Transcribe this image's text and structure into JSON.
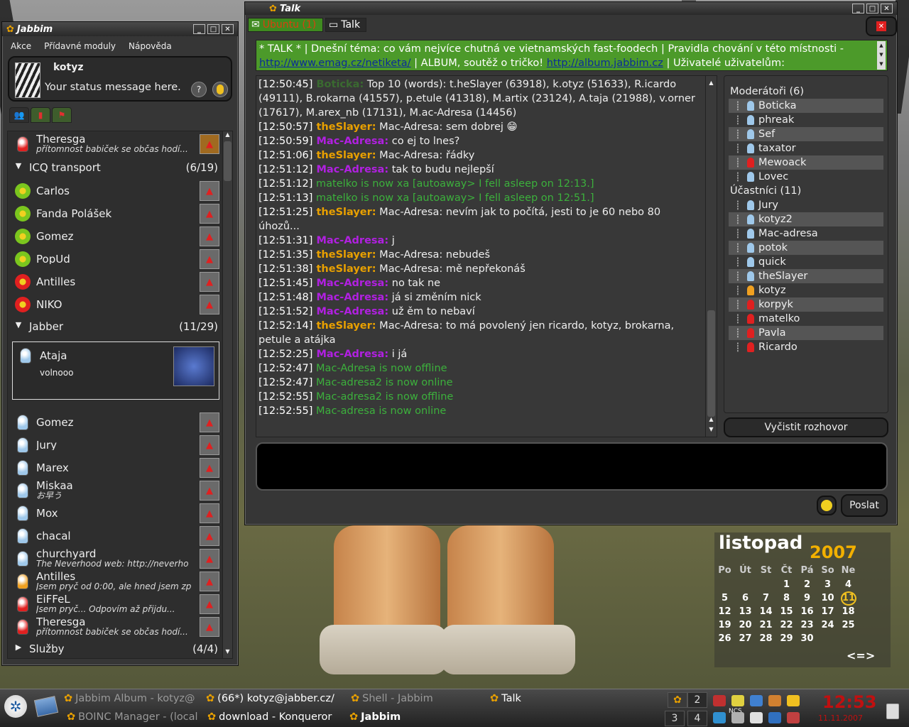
{
  "jabbim": {
    "title": "Jabbim",
    "menu": [
      "Akce",
      "Přídavné moduly",
      "Nápověda"
    ],
    "self": {
      "name": "kotyz",
      "status": "Your status message here."
    },
    "top_contact": {
      "name": "Theresga",
      "sub": "přítomnost babiček se občas hodí..."
    },
    "groups": {
      "icq": {
        "label": "ICQ transport",
        "count": "(6/19)"
      },
      "jabber": {
        "label": "Jabber",
        "count": "(11/29)"
      },
      "sluzby": {
        "label": "Služby",
        "count": "(4/4)"
      }
    },
    "icq_contacts": [
      {
        "name": "Carlos",
        "color": "#7bc61e"
      },
      {
        "name": "Fanda Polášek",
        "color": "#7bc61e"
      },
      {
        "name": "Gomez",
        "color": "#7bc61e"
      },
      {
        "name": "PopUd",
        "color": "#7bc61e"
      },
      {
        "name": "Antilles",
        "color": "#e02020"
      },
      {
        "name": "NIKO",
        "color": "#e02020"
      }
    ],
    "selected": {
      "name": "Ataja",
      "sub": "volnooo"
    },
    "jabber_contacts": [
      {
        "name": "Gomez",
        "sub": "",
        "color": "#9fc8ea"
      },
      {
        "name": "Jury",
        "sub": "",
        "color": "#9fc8ea"
      },
      {
        "name": "Marex",
        "sub": "",
        "color": "#9fc8ea"
      },
      {
        "name": "Miskaa",
        "sub": "お早う",
        "color": "#9fc8ea"
      },
      {
        "name": "Mox",
        "sub": "",
        "color": "#9fc8ea"
      },
      {
        "name": "chacal",
        "sub": "",
        "color": "#9fc8ea"
      },
      {
        "name": "churchyard",
        "sub": "The Neverhood web: http://neverho",
        "color": "#9fc8ea"
      },
      {
        "name": "Antilles",
        "sub": "Jsem pryč od 0:00, ale hned jsem zp",
        "color": "#f0a020"
      },
      {
        "name": "EiFFeL",
        "sub": "Jsem pryč... Odpovím až přijdu...",
        "color": "#e02020"
      },
      {
        "name": "Theresga",
        "sub": "přítomnost babiček se občas hodí...",
        "color": "#e02020"
      }
    ]
  },
  "talk": {
    "title": "Talk",
    "tabs": [
      "Ubuntu (1)",
      "Talk"
    ],
    "topic_pre": "* TALK * | Dnešní téma: co vám nejvíce chutná ve vietnamských fast-foodech | Pravidla chování v této místnosti - ",
    "topic_link1": "http://www.emag.cz/netiketa/",
    "topic_mid": " | ALBUM, soutěž o tričko! ",
    "topic_link2": "http://album.jabbim.cz",
    "topic_post": " | Uživatelé uživatelům:",
    "messages": [
      {
        "ts": "[12:50:45]",
        "nick": "Boticka:",
        "kind": "b",
        "text": " Top 10 (words): t.heSlayer (63918), k.otyz (51633), R.icardo (49111), B.rokarna (41557), p.etule (41318), M.artix (23124), A.taja (21988), v.orner (17617), M.arex_nb (17131), M.ac-Adresa (14456)"
      },
      {
        "ts": "[12:50:57]",
        "nick": "theSlayer:",
        "kind": "t",
        "text": " Mac-Adresa: sem dobrej 😁"
      },
      {
        "ts": "[12:50:59]",
        "nick": "Mac-Adresa:",
        "kind": "m",
        "text": " co ej to lnes?"
      },
      {
        "ts": "[12:51:06]",
        "nick": "theSlayer:",
        "kind": "t",
        "text": " Mac-Adresa: řádky"
      },
      {
        "ts": "[12:51:12]",
        "nick": "Mac-Adresa:",
        "kind": "m",
        "text": " tak to budu nejlepší"
      },
      {
        "ts": "[12:51:12]",
        "nick": "",
        "kind": "s",
        "text": " matelko is now xa [autoaway> I fell asleep on 12:13.]"
      },
      {
        "ts": "[12:51:13]",
        "nick": "",
        "kind": "s",
        "text": " matelko is now xa [autoaway> I fell asleep on 12:51.]"
      },
      {
        "ts": "[12:51:25]",
        "nick": "theSlayer:",
        "kind": "t",
        "text": " Mac-Adresa: nevím jak to počítá, jesti to je 60 nebo 80 úhozů..."
      },
      {
        "ts": "[12:51:31]",
        "nick": "Mac-Adresa:",
        "kind": "m",
        "text": " j"
      },
      {
        "ts": "[12:51:35]",
        "nick": "theSlayer:",
        "kind": "t",
        "text": " Mac-Adresa: nebudeš"
      },
      {
        "ts": "[12:51:38]",
        "nick": "theSlayer:",
        "kind": "t",
        "text": " Mac-Adresa: mě nepřekonáš"
      },
      {
        "ts": "[12:51:45]",
        "nick": "Mac-Adresa:",
        "kind": "m",
        "text": " no tak ne"
      },
      {
        "ts": "[12:51:48]",
        "nick": "Mac-Adresa:",
        "kind": "m",
        "text": " já si změním nick"
      },
      {
        "ts": "[12:51:52]",
        "nick": "Mac-Adresa:",
        "kind": "m",
        "text": " už ěm to nebaví"
      },
      {
        "ts": "[12:52:14]",
        "nick": "theSlayer:",
        "kind": "t",
        "text": " Mac-Adresa: to má povolený jen ricardo, kotyz, brokarna, petule a atájka"
      },
      {
        "ts": "[12:52:25]",
        "nick": "Mac-Adresa:",
        "kind": "m",
        "text": " i já"
      },
      {
        "ts": "[12:52:47]",
        "nick": "",
        "kind": "s",
        "text": " Mac-Adresa is now offline"
      },
      {
        "ts": "[12:52:47]",
        "nick": "",
        "kind": "s",
        "text": " Mac-adresa2 is now online"
      },
      {
        "ts": "[12:52:55]",
        "nick": "",
        "kind": "s",
        "text": " Mac-adresa2 is now offline"
      },
      {
        "ts": "[12:52:55]",
        "nick": "",
        "kind": "s",
        "text": " Mac-adresa is now online"
      }
    ],
    "moderators_header": "Moderátoři (6)",
    "moderators": [
      {
        "name": "Boticka",
        "color": "#9fc8ea"
      },
      {
        "name": "phreak",
        "color": "#9fc8ea"
      },
      {
        "name": "Sef",
        "color": "#9fc8ea"
      },
      {
        "name": "taxator",
        "color": "#9fc8ea"
      },
      {
        "name": "Mewoack",
        "color": "#e02020"
      },
      {
        "name": "Lovec",
        "color": "#9fc8ea"
      }
    ],
    "participants_header": "Účastníci (11)",
    "participants": [
      {
        "name": "Jury",
        "color": "#9fc8ea"
      },
      {
        "name": "kotyz2",
        "color": "#9fc8ea"
      },
      {
        "name": "Mac-adresa",
        "color": "#9fc8ea"
      },
      {
        "name": "potok",
        "color": "#9fc8ea"
      },
      {
        "name": "quick",
        "color": "#9fc8ea"
      },
      {
        "name": "theSlayer",
        "color": "#9fc8ea"
      },
      {
        "name": "kotyz",
        "color": "#f0a020"
      },
      {
        "name": "korpyk",
        "color": "#e02020"
      },
      {
        "name": "matelko",
        "color": "#e02020"
      },
      {
        "name": "Pavla",
        "color": "#e02020"
      },
      {
        "name": "Ricardo",
        "color": "#e02020"
      }
    ],
    "clear_button": "Vyčistit rozhovor",
    "send_button": "Poslat"
  },
  "calendar": {
    "month": "listopad",
    "year": "2007",
    "day_headers": [
      "Po",
      "Út",
      "St",
      "Čt",
      "Pá",
      "So",
      "Ne"
    ],
    "weeks": [
      [
        "",
        "",
        "",
        "1",
        "2",
        "3",
        "4"
      ],
      [
        "5",
        "6",
        "7",
        "8",
        "9",
        "10",
        "11"
      ],
      [
        "12",
        "13",
        "14",
        "15",
        "16",
        "17",
        "18"
      ],
      [
        "19",
        "20",
        "21",
        "22",
        "23",
        "24",
        "25"
      ],
      [
        "26",
        "27",
        "28",
        "29",
        "30",
        "",
        ""
      ]
    ],
    "today": "11",
    "nav": "<=>"
  },
  "taskbar": {
    "tasks_row1": [
      {
        "label": "Jabbim Album - kotyz@",
        "active": false
      },
      {
        "label": "(66*) kotyz@jabber.cz/",
        "active": true
      },
      {
        "label": "Shell - Jabbim",
        "active": false
      },
      {
        "label": "Talk",
        "active": true
      }
    ],
    "tasks_row2": [
      {
        "label": "BOINC Manager - (local",
        "active": false
      },
      {
        "label": "download - Konqueror",
        "active": true
      },
      {
        "label": "Jabbim",
        "active": true
      }
    ],
    "pager": [
      "2",
      "3",
      "4"
    ],
    "tray_label": "NCS",
    "clock_time": "12:53",
    "clock_date": "11.11.2007"
  }
}
